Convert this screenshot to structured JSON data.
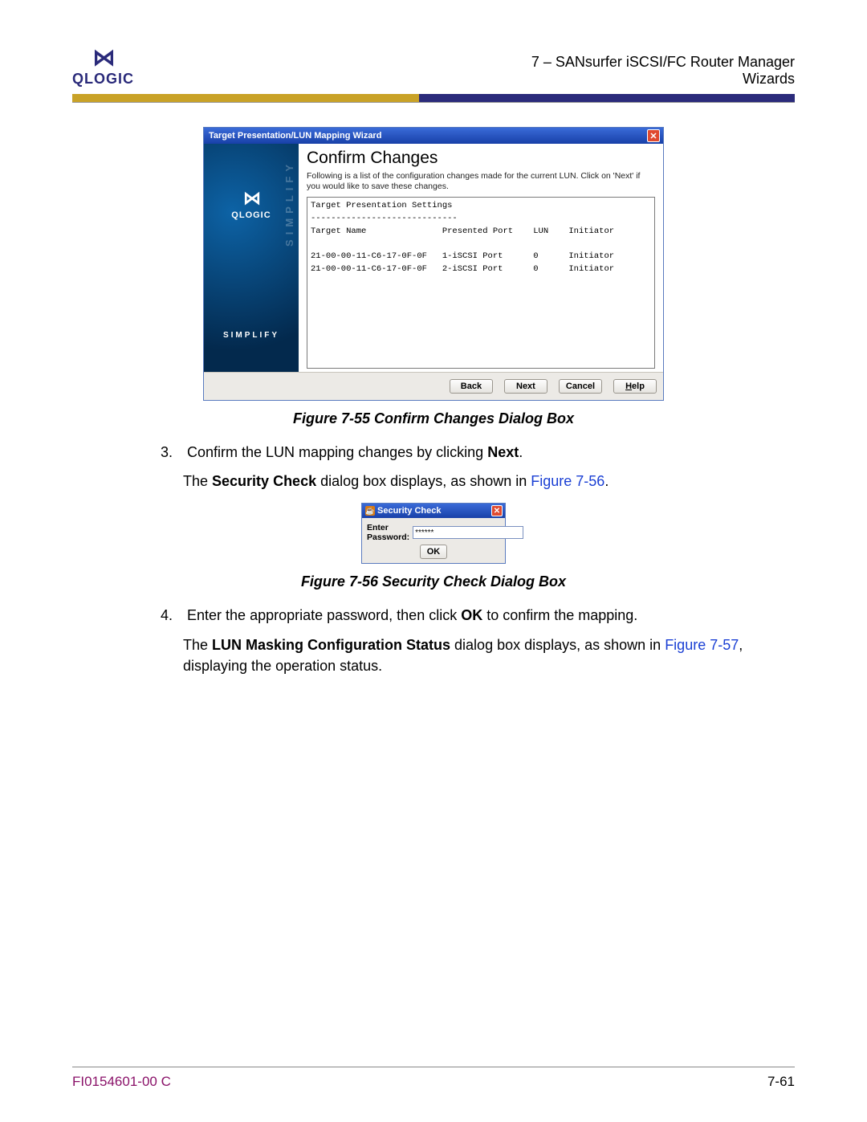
{
  "header": {
    "logo_brand": "QLOGIC",
    "chapter": "7 – SANsurfer iSCSI/FC Router Manager",
    "section": "Wizards"
  },
  "wizard55": {
    "title": "Target Presentation/LUN Mapping Wizard",
    "heading": "Confirm Changes",
    "description": "Following is a list of the configuration changes made for the current LUN.  Click on 'Next' if you would like to save these changes.",
    "listing_heading": "Target Presentation Settings",
    "dash": "-----------------------------",
    "cols": "Target Name               Presented Port    LUN    Initiator",
    "row1": "21-00-00-11-C6-17-0F-0F   1-iSCSI Port      0      Initiator",
    "row2": "21-00-00-11-C6-17-0F-0F   2-iSCSI Port      0      Initiator",
    "side_brand": "QLOGIC",
    "side_vert": "SIMPLIFY",
    "simplify": "SIMPLIFY",
    "buttons": {
      "back": "Back",
      "next": "Next",
      "cancel": "Cancel",
      "help": "Help"
    }
  },
  "captions": {
    "fig55": "Figure 7-55  Confirm Changes Dialog Box",
    "fig56": "Figure 7-56  Security Check Dialog Box"
  },
  "para": {
    "step3_num": "3.",
    "step3a_pre": "Confirm the LUN mapping changes by clicking ",
    "step3a_bold": "Next",
    "step3a_post": ".",
    "step3b_pre": "The ",
    "step3b_bold": "Security Check",
    "step3b_mid": " dialog box displays, as shown in ",
    "step3b_link": "Figure 7-56",
    "step3b_post": ".",
    "step4_num": "4.",
    "step4a_pre": "Enter the appropriate password, then click ",
    "step4a_bold": "OK",
    "step4a_post": " to confirm the mapping.",
    "step4b_pre": "The ",
    "step4b_bold": "LUN Masking Configuration Status",
    "step4b_mid": " dialog box displays, as shown in ",
    "step4b_link": "Figure 7-57",
    "step4b_post": ", displaying the operation status."
  },
  "secdialog": {
    "title": "Security Check",
    "label": "Enter Password:",
    "value": "******",
    "ok": "OK"
  },
  "footer": {
    "docnum": "FI0154601-00  C",
    "page": "7-61"
  }
}
